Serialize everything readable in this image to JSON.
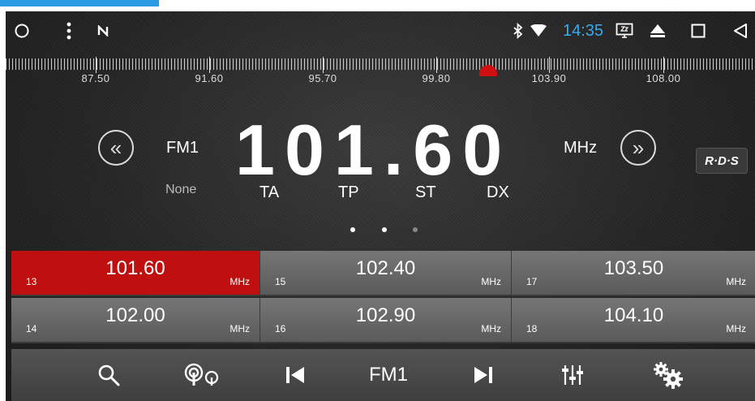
{
  "status_bar": {
    "time": "14:35"
  },
  "scale": {
    "labels": [
      "87.50",
      "91.60",
      "95.70",
      "99.80",
      "103.90",
      "108.00"
    ]
  },
  "tuner": {
    "band": "FM1",
    "frequency": "101.60",
    "unit": "MHz",
    "rds_label": "R·D·S",
    "pty": "None",
    "flags": [
      "TA",
      "TP",
      "ST",
      "DX"
    ],
    "page_indicator": {
      "total": 3,
      "active": 2
    }
  },
  "presets": [
    {
      "number": "13",
      "frequency": "101.60",
      "unit": "MHz",
      "active": true
    },
    {
      "number": "15",
      "frequency": "102.40",
      "unit": "MHz",
      "active": false
    },
    {
      "number": "17",
      "frequency": "103.50",
      "unit": "MHz",
      "active": false
    },
    {
      "number": "14",
      "frequency": "102.00",
      "unit": "MHz",
      "active": false
    },
    {
      "number": "16",
      "frequency": "102.90",
      "unit": "MHz",
      "active": false
    },
    {
      "number": "18",
      "frequency": "104.10",
      "unit": "MHz",
      "active": false
    }
  ],
  "toolbar": {
    "band_label": "FM1",
    "icons": [
      "search-icon",
      "antenna-icon",
      "previous-track-icon",
      "next-track-icon",
      "equalizer-icon",
      "settings-icon"
    ]
  },
  "colors": {
    "accent_red": "#c00f0f",
    "time_blue": "#3aa9f0",
    "top_strip": "#2c9be6"
  }
}
